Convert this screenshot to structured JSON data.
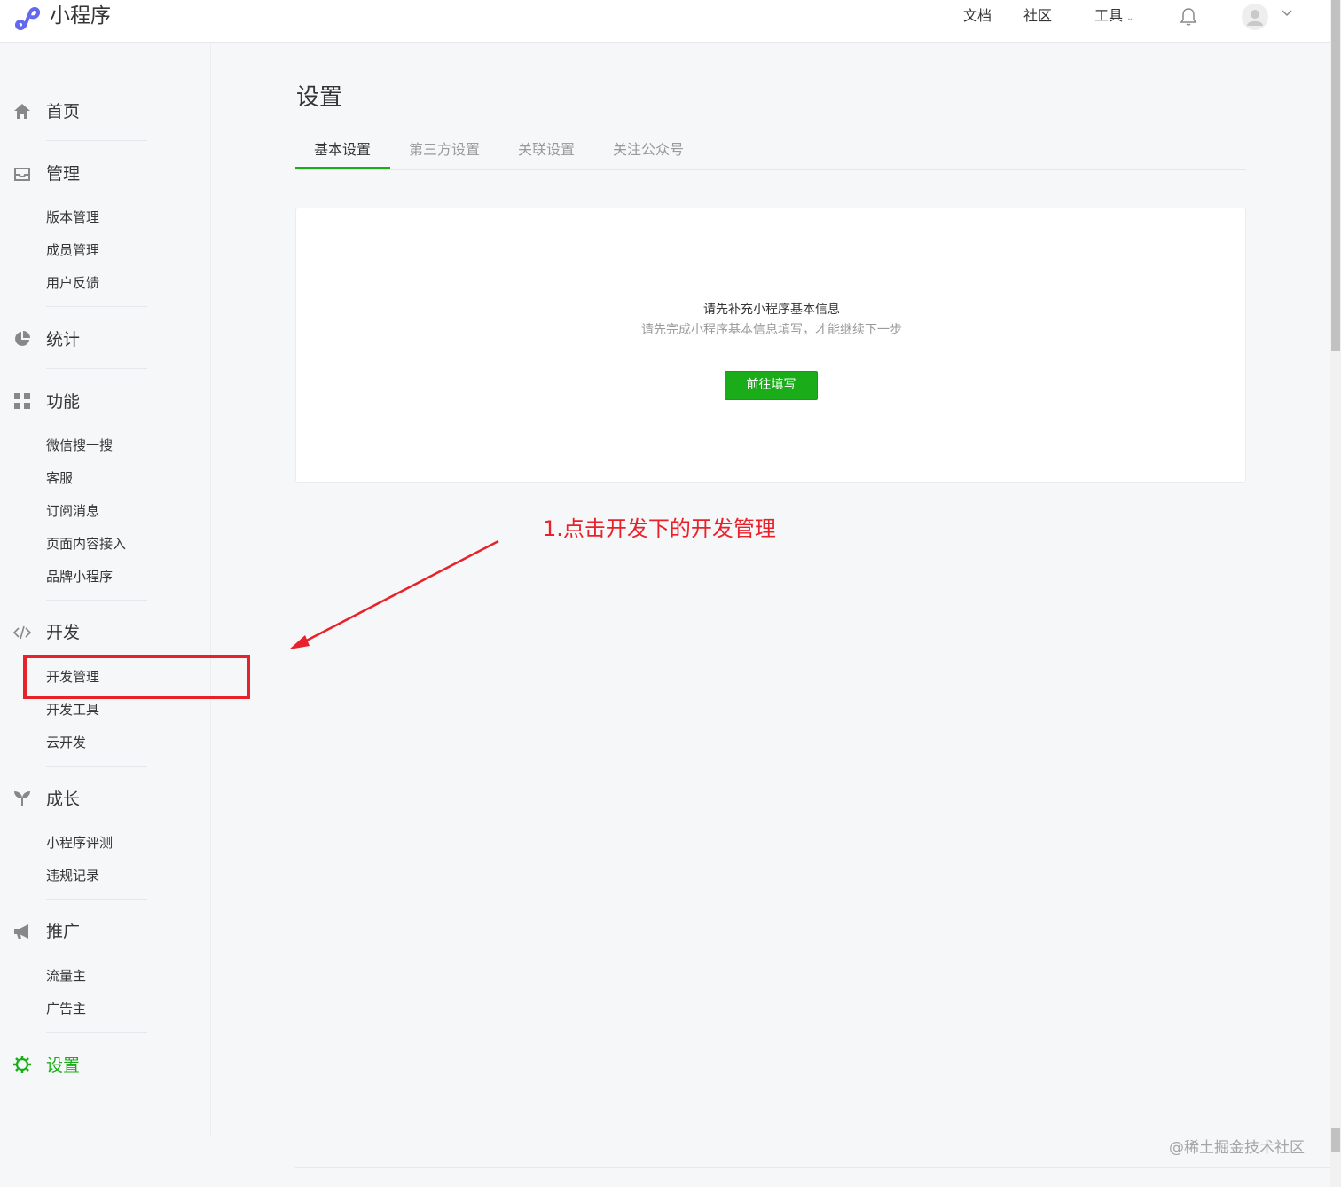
{
  "topbar": {
    "brand": "小程序",
    "nav": [
      "文档",
      "社区",
      "工具"
    ]
  },
  "sidebar": {
    "home": "首页",
    "manage": {
      "title": "管理",
      "items": [
        "版本管理",
        "成员管理",
        "用户反馈"
      ]
    },
    "stats": "统计",
    "features": {
      "title": "功能",
      "items": [
        "微信搜一搜",
        "客服",
        "订阅消息",
        "页面内容接入",
        "品牌小程序"
      ]
    },
    "dev": {
      "title": "开发",
      "items": [
        "开发管理",
        "开发工具",
        "云开发"
      ]
    },
    "growth": {
      "title": "成长",
      "items": [
        "小程序评测",
        "违规记录"
      ]
    },
    "promo": {
      "title": "推广",
      "items": [
        "流量主",
        "广告主"
      ]
    },
    "settings": "设置"
  },
  "main": {
    "title": "设置",
    "tabs": [
      "基本设置",
      "第三方设置",
      "关联设置",
      "关注公众号"
    ],
    "card": {
      "title": "请先补充小程序基本信息",
      "desc": "请先完成小程序基本信息填写，才能继续下一步",
      "button": "前往填写"
    }
  },
  "annotation": "1.点击开发下的开发管理",
  "watermark": "@稀土掘金技术社区",
  "colors": {
    "accent": "#1aad19",
    "annotation": "#e8222b"
  }
}
